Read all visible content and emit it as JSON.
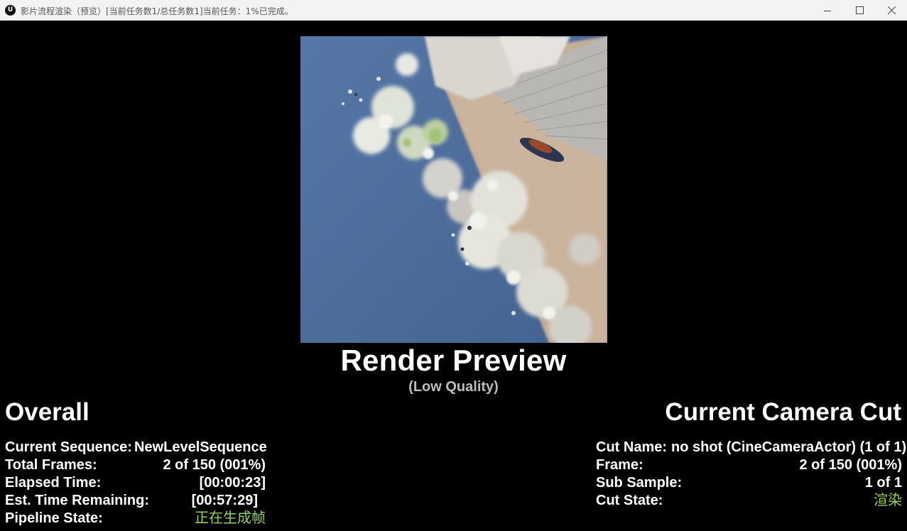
{
  "window": {
    "title": "影片流程渲染（预览）[当前任务数1/总任务数1]当前任务：1%已完成。",
    "logo_text": "U",
    "controls": [
      "minimize-icon",
      "maximize-icon",
      "close-icon"
    ]
  },
  "preview": {
    "title": "Render Preview",
    "subtitle": "(Low Quality)"
  },
  "overall": {
    "heading": "Overall",
    "rows": [
      {
        "label": "Current Sequence:",
        "value": "NewLevelSequence"
      },
      {
        "label": "Total Frames:",
        "value": "2 of 150 (001%)"
      },
      {
        "label": "Elapsed Time:",
        "value": "[00:00:23]"
      },
      {
        "label": "Est. Time Remaining:",
        "value": "[00:57:29]"
      },
      {
        "label": "Pipeline State:",
        "value": "正在生成帧"
      }
    ]
  },
  "camera_cut": {
    "heading": "Current Camera Cut",
    "rows": [
      {
        "label": "Cut Name:",
        "value": "no shot (CineCameraActor) (1 of 1)"
      },
      {
        "label": "Frame:",
        "value": "2 of 150 (001%)"
      },
      {
        "label": "Sub Sample:",
        "value": "1 of 1"
      },
      {
        "label": "Cut State:",
        "value": "渲染"
      }
    ]
  },
  "colors": {
    "background": "#000000",
    "titlebar": "#f3f3f3",
    "state_text": "#8fd65a",
    "subtitle": "#bdbdbd"
  }
}
